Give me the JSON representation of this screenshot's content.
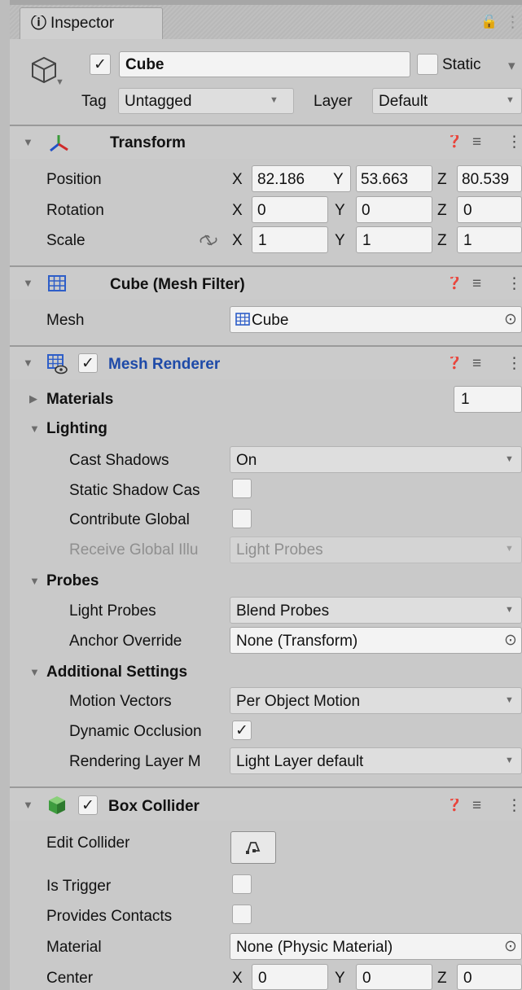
{
  "tab": {
    "label": "Inspector",
    "info_glyph": "ⓘ",
    "lock_glyph": "🔓",
    "menu_glyph": "⋮"
  },
  "object": {
    "name": "Cube",
    "active_check": "✓",
    "static_label": "Static",
    "static_arrow": "▾",
    "tag_label": "Tag",
    "tag_value": "Untagged",
    "layer_label": "Layer",
    "layer_value": "Default"
  },
  "glyphs": {
    "fold_open": "▼",
    "fold_closed": "▶",
    "dropdown": "▼",
    "help": "❓",
    "presets": "≡",
    "menu": "⋮",
    "check": "✓",
    "target": "⊙"
  },
  "transform": {
    "title": "Transform",
    "position": {
      "label": "Position",
      "x": "82.186",
      "y": "53.663",
      "z": "80.539"
    },
    "rotation": {
      "label": "Rotation",
      "x": "0",
      "y": "0",
      "z": "0"
    },
    "scale": {
      "label": "Scale",
      "x": "1",
      "y": "1",
      "z": "1"
    },
    "axis_x": "X",
    "axis_y": "Y",
    "axis_z": "Z"
  },
  "mesh_filter": {
    "title": "Cube (Mesh Filter)",
    "mesh_label": "Mesh",
    "mesh_value": "Cube"
  },
  "mesh_renderer": {
    "title": "Mesh Renderer",
    "materials_label": "Materials",
    "materials_count": "1",
    "lighting_label": "Lighting",
    "cast_shadows_label": "Cast Shadows",
    "cast_shadows_value": "On",
    "static_shadow_label": "Static Shadow Cas",
    "contribute_gi_label": "Contribute Global",
    "receive_gi_label": "Receive Global Illu",
    "receive_gi_value": "Light Probes",
    "probes_label": "Probes",
    "light_probes_label": "Light Probes",
    "light_probes_value": "Blend Probes",
    "anchor_label": "Anchor Override",
    "anchor_value": "None (Transform)",
    "additional_label": "Additional Settings",
    "motion_label": "Motion Vectors",
    "motion_value": "Per Object Motion",
    "occlusion_label": "Dynamic Occlusion",
    "rendering_layer_label": "Rendering Layer M",
    "rendering_layer_value": "Light Layer default"
  },
  "box_collider": {
    "title": "Box Collider",
    "edit_label": "Edit Collider",
    "trigger_label": "Is Trigger",
    "contacts_label": "Provides Contacts",
    "material_label": "Material",
    "material_value": "None (Physic Material)",
    "center_label": "Center",
    "cx": "0",
    "cy": "0",
    "cz": "0"
  },
  "colors": {
    "component_title_blue": "#1e4aa8",
    "panel_bg": "#c9c9c9",
    "field_bg": "#f3f3f3"
  }
}
